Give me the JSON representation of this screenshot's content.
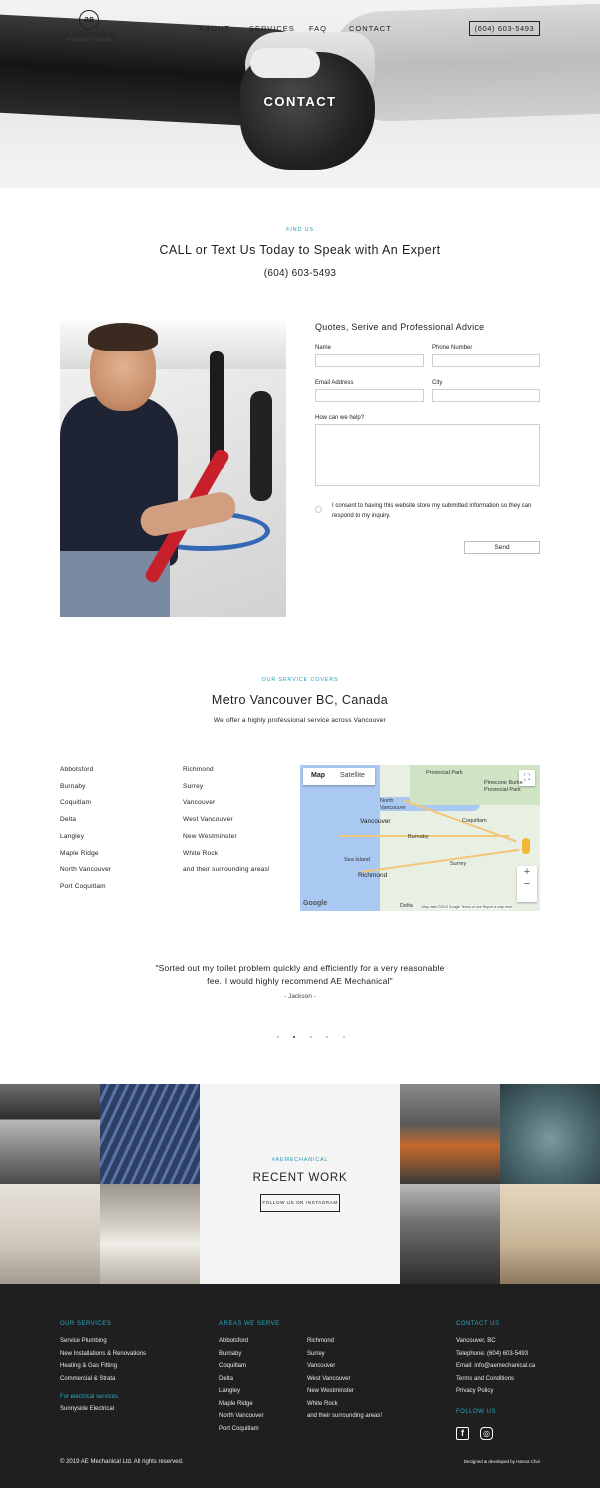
{
  "header": {
    "logo_mark": "ae",
    "logo_name": "AE MECHANICAL",
    "logo_sub": "PLUMBING & HEATING",
    "nav": [
      "ABOUT",
      "SERVICES",
      "FAQ",
      "CONTACT"
    ],
    "phone_button": "(604) 603-5493",
    "hero_title": "CONTACT"
  },
  "find_us": {
    "eyebrow": "FIND US",
    "heading": "CALL or Text Us Today to Speak with An Expert",
    "phone": "(604) 603-5493"
  },
  "form": {
    "title": "Quotes, Serive and Professional Advice",
    "name_label": "Name",
    "phone_label": "Phone Number",
    "email_label": "Email Address",
    "city_label": "City",
    "message_label": "How can we help?",
    "consent": "I consent to having this website store my submitted information so they can respond to my inquiry.",
    "send_label": "Send"
  },
  "service_areas": {
    "eyebrow": "OUR SERVICE COVERS",
    "heading": "Metro Vancouver BC, Canada",
    "subheading": "We offer a highly professional service across Vancouver",
    "column_1": [
      "Abbotsford",
      "Burnaby",
      "Coquitlam",
      "Delta",
      "Langley",
      "Maple Ridge",
      "North Vancouver",
      "Port Coquitlam"
    ],
    "column_2": [
      "Richmond",
      "Surrey",
      "Vancouver",
      "West Vancouver",
      "New Westminster",
      "White Rock",
      "and their surrounding areas!"
    ]
  },
  "map": {
    "tab_map": "Map",
    "tab_satellite": "Satellite",
    "labels": {
      "vancouver": "Vancouver",
      "north_vancouver": "North Vancouver",
      "burnaby": "Burnaby",
      "coquitlam": "Coquitlam",
      "sea_island": "Sea Island",
      "richmond": "Richmond",
      "surrey": "Surrey",
      "delta": "Delta",
      "provincial_park": "Provincial Park",
      "pinecone_burke": "Pinecone Burke Provincial Park"
    },
    "google": "Google",
    "attribution": "Map data ©2019 Google   Terms of Use   Report a map error"
  },
  "testimonial": {
    "quote": "\"Sorted out my toilet problem quickly and efficiently for a very reasonable fee. I would highly recommend AE Mechanical\"",
    "author": "- Jackson -",
    "active_dot": 1
  },
  "recent_work": {
    "tag": "#AEMECHANICAL",
    "title": "RECENT WORK",
    "button": "FOLLOW US ON INSTAGRAM"
  },
  "footer": {
    "services_heading": "OUR SERVICES",
    "services": [
      "Service Plumbing",
      "New Installations & Renovations",
      "Heating & Gas Fitting",
      "Commercial & Strata"
    ],
    "electrical_heading": "For electrical services",
    "electrical_link": "Sunnyside Electrical",
    "areas_heading": "AREAS WE SERVE",
    "areas_col_1": [
      "Abbotsford",
      "Burnaby",
      "Coquitlam",
      "Delta",
      "Langley",
      "Maple Ridge",
      "North Vancouver",
      "Port Coquitlam"
    ],
    "areas_col_2": [
      "Richmond",
      "Surrey",
      "Vancouver",
      "West Vancouver",
      "New Westminster",
      "White Rock",
      "and their surrounding areas!"
    ],
    "contact_heading": "CONTACT US",
    "contact": [
      "Vancouver, BC",
      "Telephone: (604) 603-5493",
      "Email: info@aemechanical.ca",
      "Terms and Conditions",
      "Privacy Policy"
    ],
    "follow_heading": "FOLLOW US",
    "facebook_glyph": "f",
    "instagram_glyph": "◎",
    "copyright": "© 2019 AE Mechanical Ltd. All rights reserved.",
    "credit": "Designed & developed by Hanna Choi"
  },
  "colors": {
    "accent": "#2a9db5",
    "footer_bg": "#1f1f1f"
  }
}
